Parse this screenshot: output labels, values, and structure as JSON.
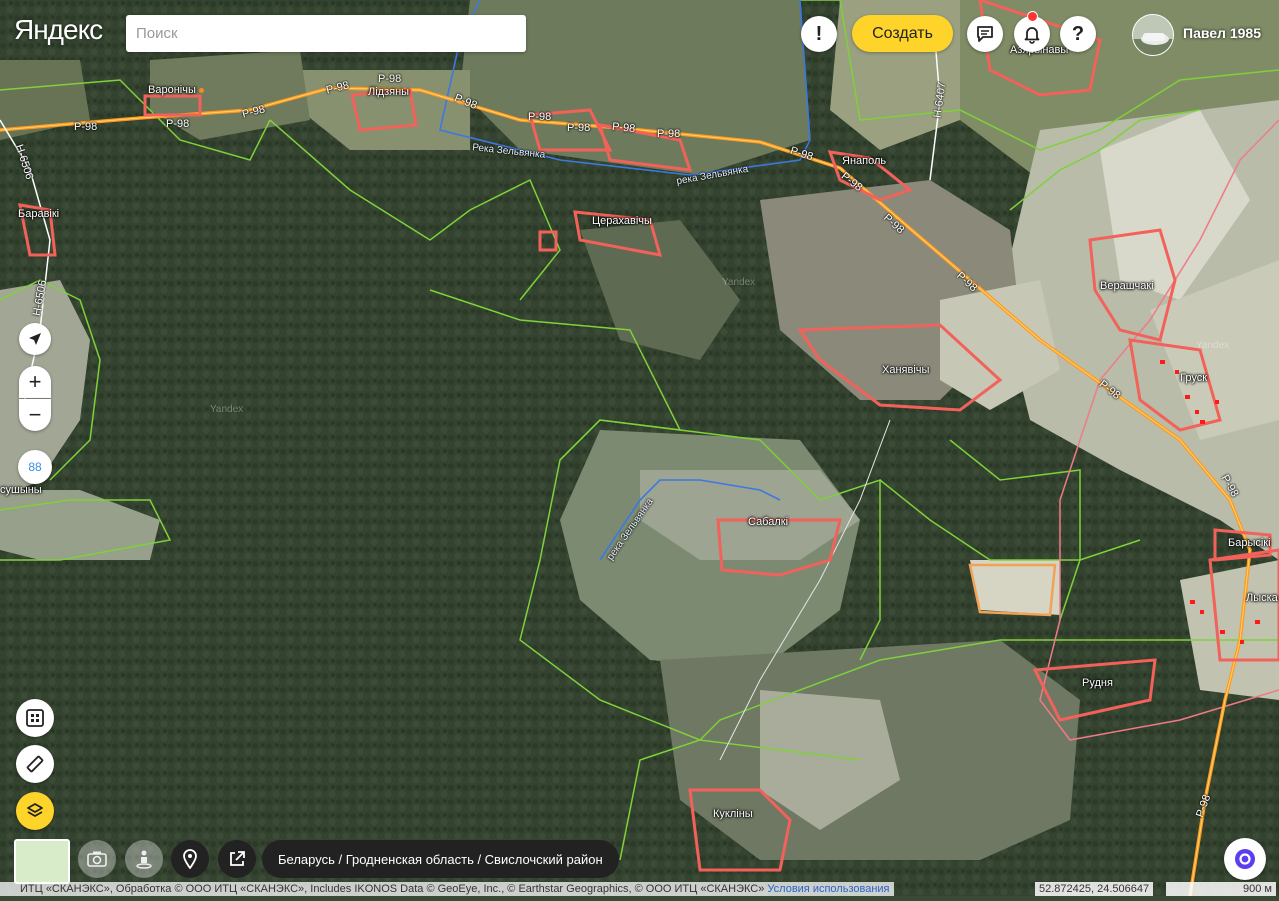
{
  "header": {
    "logo": "Яндекс",
    "search_placeholder": "Поиск",
    "info_label": "!",
    "create_label": "Создать",
    "help_label": "?",
    "user_name": "Павел 1985"
  },
  "controls": {
    "zoom_in": "+",
    "zoom_out": "−",
    "speed_badge": "88"
  },
  "breadcrumb": "Беларусь / Гродненская область / Свислочский район",
  "footer": {
    "attribution": "ИТЦ «СКАНЭКС», Обработка © ООО ИТЦ «СКАНЭКС», Includes IKONOS Data © GeoEye, Inc., © Earthstar Geographics, © ООО ИТЦ «СКАНЭКС»",
    "terms": "Условия использования",
    "coordinates": "52.872425, 24.506647",
    "scale": "900 м"
  },
  "places": {
    "varonichy": "Варонічы",
    "lidzyany": "Лідзяны",
    "baraviki": "Баравікі",
    "yanapol": "Янаполь",
    "tserakhavichy": "Церахавічы",
    "khanyavichy": "Ханявічы",
    "verashchaki": "Верашчакі",
    "grusk": "Груск",
    "sabalki": "Сабалкі",
    "barysiki": "Барысікі",
    "lyskа": "Лыска",
    "rudnya": "Рудня",
    "kuklichy": "Кукліны",
    "susyny": "сушыны",
    "top_village": "Азярынавы"
  },
  "roads": {
    "p98": "P-98",
    "h6506": "H-6506",
    "h6407": "H-6407",
    "h6506b": "H-6506"
  },
  "rivers": {
    "zelvyanka_1": "Река Зельвянка",
    "zelvyanka_2": "река Зельвянка",
    "zelvyanka_3": "река Зельвянка"
  },
  "watermarks": {
    "yandex": "Yandex"
  }
}
